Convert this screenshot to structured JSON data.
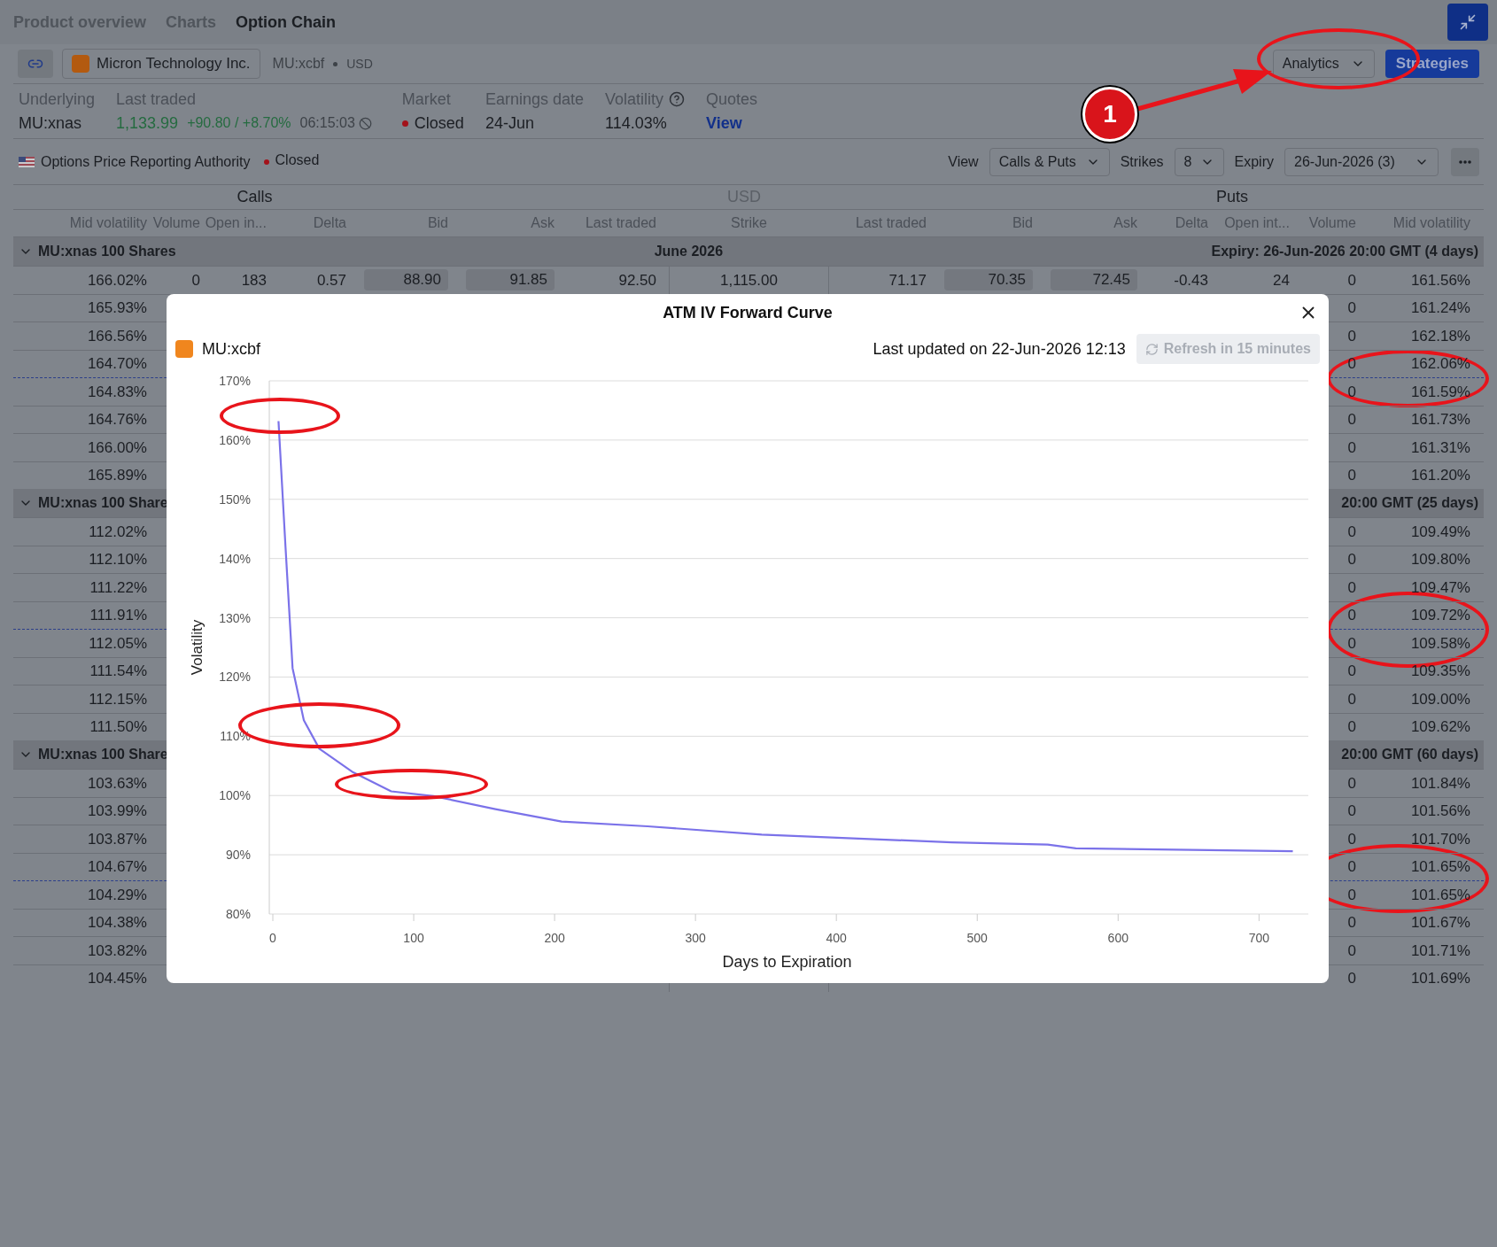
{
  "tabs": [
    {
      "label": "Product overview",
      "selected": false
    },
    {
      "label": "Charts",
      "selected": false
    },
    {
      "label": "Option Chain",
      "selected": true
    }
  ],
  "instrument": {
    "name": "Micron Technology Inc.",
    "symbol": "MU:xcbf",
    "currency": "USD"
  },
  "toolbar": {
    "analytics": "Analytics",
    "strategies": "Strategies"
  },
  "summary": {
    "underlying": {
      "label": "Underlying",
      "value": "MU:xnas"
    },
    "last_traded": {
      "label": "Last traded",
      "price": "1,133.99",
      "change": "+90.80 / +8.70%",
      "time": "06:15:03"
    },
    "market": {
      "label": "Market",
      "value": "Closed"
    },
    "earnings": {
      "label": "Earnings date",
      "value": "24-Jun"
    },
    "volatility": {
      "label": "Volatility",
      "value": "114.03%"
    },
    "quotes": {
      "label": "Quotes",
      "link": "View"
    }
  },
  "exchange": {
    "name": "Options Price Reporting Authority",
    "status": "Closed"
  },
  "controls": {
    "view_label": "View",
    "view": "Calls & Puts",
    "strikes_label": "Strikes",
    "strikes": "8",
    "expiry_label": "Expiry",
    "expiry": "26-Jun-2026 (3)"
  },
  "table": {
    "sections": [
      "Calls",
      "USD",
      "Puts"
    ],
    "columns": [
      "Mid volatility",
      "Volume",
      "Open in...",
      "Delta",
      "Bid",
      "Ask",
      "Last traded",
      "Strike",
      "Last traded",
      "Bid",
      "Ask",
      "Delta",
      "Open int...",
      "Volume",
      "Mid volatility"
    ],
    "groups": [
      {
        "label": "MU:xnas 100 Shares",
        "month": "June 2026",
        "expiry": "Expiry: 26-Jun-2026 20:00 GMT (4 days)",
        "expanded": true,
        "rows": [
          {
            "call_mid_volatility": "166.02%",
            "call_volume": "0",
            "call_open_interest": "183",
            "call_delta": "0.57",
            "call_bid": "88.90",
            "call_ask": "91.85",
            "call_last_traded": "92.50",
            "strike": "1,115.00",
            "put_last_traded": "71.17",
            "put_bid": "70.35",
            "put_ask": "72.45",
            "put_delta": "-0.43",
            "put_open_interest": "24",
            "put_volume": "0",
            "put_mid_volatility": "161.56%",
            "atm_divider": false
          },
          {
            "call_mid_volatility": "165.93%",
            "put_volume": "0",
            "put_mid_volatility": "161.24%",
            "atm_divider": false
          },
          {
            "call_mid_volatility": "166.56%",
            "put_volume": "0",
            "put_mid_volatility": "162.18%",
            "atm_divider": false
          },
          {
            "call_mid_volatility": "164.70%",
            "put_volume": "0",
            "put_mid_volatility": "162.06%",
            "atm_divider": false
          },
          {
            "call_mid_volatility": "164.83%",
            "put_volume": "0",
            "put_mid_volatility": "161.59%",
            "atm_divider": true
          },
          {
            "call_mid_volatility": "164.76%",
            "put_volume": "0",
            "put_mid_volatility": "161.73%",
            "atm_divider": false
          },
          {
            "call_mid_volatility": "166.00%",
            "put_volume": "0",
            "put_mid_volatility": "161.31%",
            "atm_divider": false
          },
          {
            "call_mid_volatility": "165.89%",
            "put_volume": "0",
            "put_mid_volatility": "161.20%",
            "atm_divider": false
          }
        ]
      },
      {
        "label": "MU:xnas 100 Share",
        "expiry": "20:00 GMT (25 days)",
        "expanded": true,
        "rows": [
          {
            "call_mid_volatility": "112.02%",
            "put_volume": "0",
            "put_mid_volatility": "109.49%",
            "atm_divider": false
          },
          {
            "call_mid_volatility": "112.10%",
            "put_volume": "0",
            "put_mid_volatility": "109.80%",
            "atm_divider": false
          },
          {
            "call_mid_volatility": "111.22%",
            "put_volume": "0",
            "put_mid_volatility": "109.47%",
            "atm_divider": false
          },
          {
            "call_mid_volatility": "111.91%",
            "put_volume": "0",
            "put_mid_volatility": "109.72%",
            "atm_divider": false
          },
          {
            "call_mid_volatility": "112.05%",
            "put_volume": "0",
            "put_mid_volatility": "109.58%",
            "atm_divider": true
          },
          {
            "call_mid_volatility": "111.54%",
            "put_volume": "0",
            "put_mid_volatility": "109.35%",
            "atm_divider": false
          },
          {
            "call_mid_volatility": "112.15%",
            "put_volume": "0",
            "put_mid_volatility": "109.00%",
            "atm_divider": false
          },
          {
            "call_mid_volatility": "111.50%",
            "put_volume": "0",
            "put_mid_volatility": "109.62%",
            "atm_divider": false
          }
        ]
      },
      {
        "label": "MU:xnas 100 Share",
        "expiry": "20:00 GMT (60 days)",
        "expanded": true,
        "rows": [
          {
            "call_mid_volatility": "103.63%",
            "put_volume": "0",
            "put_mid_volatility": "101.84%",
            "atm_divider": false
          },
          {
            "call_mid_volatility": "103.99%",
            "put_volume": "0",
            "put_mid_volatility": "101.56%",
            "atm_divider": false
          },
          {
            "call_mid_volatility": "103.87%",
            "put_volume": "0",
            "put_mid_volatility": "101.70%",
            "atm_divider": false
          },
          {
            "call_mid_volatility": "104.67%",
            "put_volume": "0",
            "put_mid_volatility": "101.65%",
            "atm_divider": false
          },
          {
            "call_mid_volatility": "104.29%",
            "put_volume": "0",
            "put_mid_volatility": "101.65%",
            "atm_divider": true
          },
          {
            "call_mid_volatility": "104.38%",
            "put_volume": "0",
            "put_mid_volatility": "101.67%",
            "atm_divider": false
          },
          {
            "call_mid_volatility": "103.82%",
            "put_volume": "0",
            "put_mid_volatility": "101.71%",
            "atm_divider": false
          },
          {
            "call_mid_volatility": "104.45%",
            "put_volume": "0",
            "put_mid_volatility": "101.69%",
            "atm_divider": false
          }
        ]
      }
    ]
  },
  "modal": {
    "title": "ATM IV Forward Curve",
    "symbol": "MU:xcbf",
    "updated": "Last updated on 22-Jun-2026 12:13",
    "refresh": {
      "label": "Refresh in 15 minutes",
      "disabled": true
    },
    "chart_data": {
      "type": "line",
      "xlabel": "Days to Expiration",
      "ylabel": "Volatility",
      "xlim": [
        0,
        735
      ],
      "ylim": [
        80,
        170
      ],
      "grid": true,
      "xticks": [
        {
          "value": 0,
          "label": "0"
        },
        {
          "value": 100,
          "label": "100"
        },
        {
          "value": 200,
          "label": "200"
        },
        {
          "value": 300,
          "label": "300"
        },
        {
          "value": 400,
          "label": "400"
        },
        {
          "value": 500,
          "label": "500"
        },
        {
          "value": 600,
          "label": "600"
        },
        {
          "value": 700,
          "label": "700"
        }
      ],
      "yticks": [
        {
          "value": 80,
          "label": "80%"
        },
        {
          "value": 90,
          "label": "90%"
        },
        {
          "value": 100,
          "label": "100%"
        },
        {
          "value": 110,
          "label": "110%"
        },
        {
          "value": 120,
          "label": "120%"
        },
        {
          "value": 130,
          "label": "130%"
        },
        {
          "value": 140,
          "label": "140%"
        },
        {
          "value": 150,
          "label": "150%"
        },
        {
          "value": 160,
          "label": "160%"
        },
        {
          "value": 170,
          "label": "170%"
        }
      ],
      "x": [
        4,
        9,
        14,
        22,
        33,
        57,
        84,
        114,
        158,
        205,
        266,
        347,
        482,
        550,
        570,
        724
      ],
      "series": [
        {
          "color": "#7b72e9",
          "values": [
            163.2,
            142,
            121.5,
            112.7,
            107.9,
            103.9,
            100.7,
            99.9,
            97.7,
            95.6,
            94.8,
            93.4,
            92.1,
            91.7,
            91.1,
            90.6
          ]
        }
      ]
    }
  },
  "annotation": {
    "badge": "1"
  }
}
